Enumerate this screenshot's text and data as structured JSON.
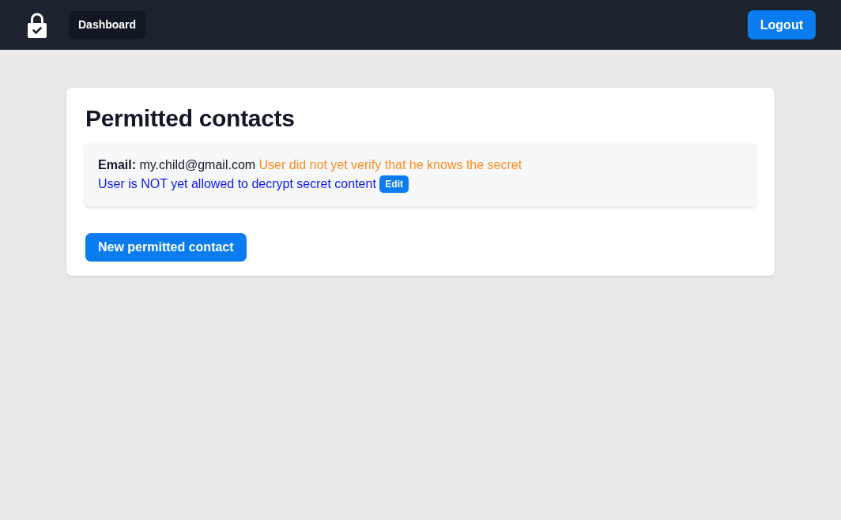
{
  "navbar": {
    "nav_links": [
      "Dashboard"
    ],
    "logout_button": "Logout"
  },
  "page": {
    "title": "Permitted contacts",
    "contacts": [
      {
        "email_label": "Email:",
        "email": "my.child@gmail.com",
        "statuses": [
          {
            "text": "User did not yet verify that he knows the secret",
            "color": "#fd8c1f"
          },
          {
            "text": "User is NOT yet allowed to decrypt secret content",
            "color": "#0a17f2"
          }
        ],
        "edit_button": "Edit"
      }
    ],
    "new_button": "New permitted contact"
  }
}
